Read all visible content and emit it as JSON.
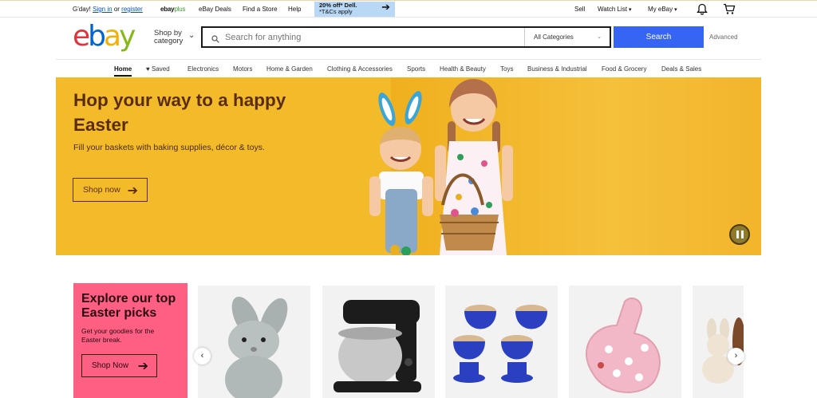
{
  "topbar": {
    "greeting": "G'day!",
    "sign_in": "Sign in",
    "or": "or",
    "register": "register",
    "ebayplus_a": "ebay",
    "ebayplus_b": "plus",
    "ebay_deals": "eBay Deals",
    "find_store": "Find a Store",
    "help": "Help",
    "promo_line1": "20% off* Dell.",
    "promo_line2": "*T&Cs apply",
    "sell": "Sell",
    "watch_list": "Watch List",
    "my_ebay": "My eBay"
  },
  "header": {
    "logo": [
      "e",
      "b",
      "a",
      "y"
    ],
    "shop_by_line1": "Shop by",
    "shop_by_line2": "category",
    "search_placeholder": "Search for anything",
    "category": "All Categories",
    "search_button": "Search",
    "advanced": "Advanced"
  },
  "nav": {
    "home": "Home",
    "saved": "Saved",
    "electronics": "Electronics",
    "motors": "Motors",
    "home_garden": "Home & Garden",
    "clothing": "Clothing & Accessories",
    "sports": "Sports",
    "health": "Health & Beauty",
    "toys": "Toys",
    "business": "Business & Industrial",
    "food": "Food & Grocery",
    "deals": "Deals & Sales"
  },
  "hero": {
    "title": "Hop your way to a happy Easter",
    "subtitle": "Fill your baskets with baking supplies, décor & toys.",
    "cta": "Shop now"
  },
  "tile": {
    "title": "Explore our top Easter picks",
    "subtitle": "Get your goodies for the Easter break.",
    "cta": "Shop Now"
  },
  "colors": {
    "brand_blue": "#3665f3",
    "hero_bg": "#f3ba2a",
    "tile_bg": "#ff5f82"
  },
  "icons": [
    "search-icon",
    "bell-icon",
    "cart-icon",
    "heart-icon",
    "arrow-right-icon",
    "pause-icon",
    "chevron-left-icon",
    "chevron-right-icon"
  ]
}
